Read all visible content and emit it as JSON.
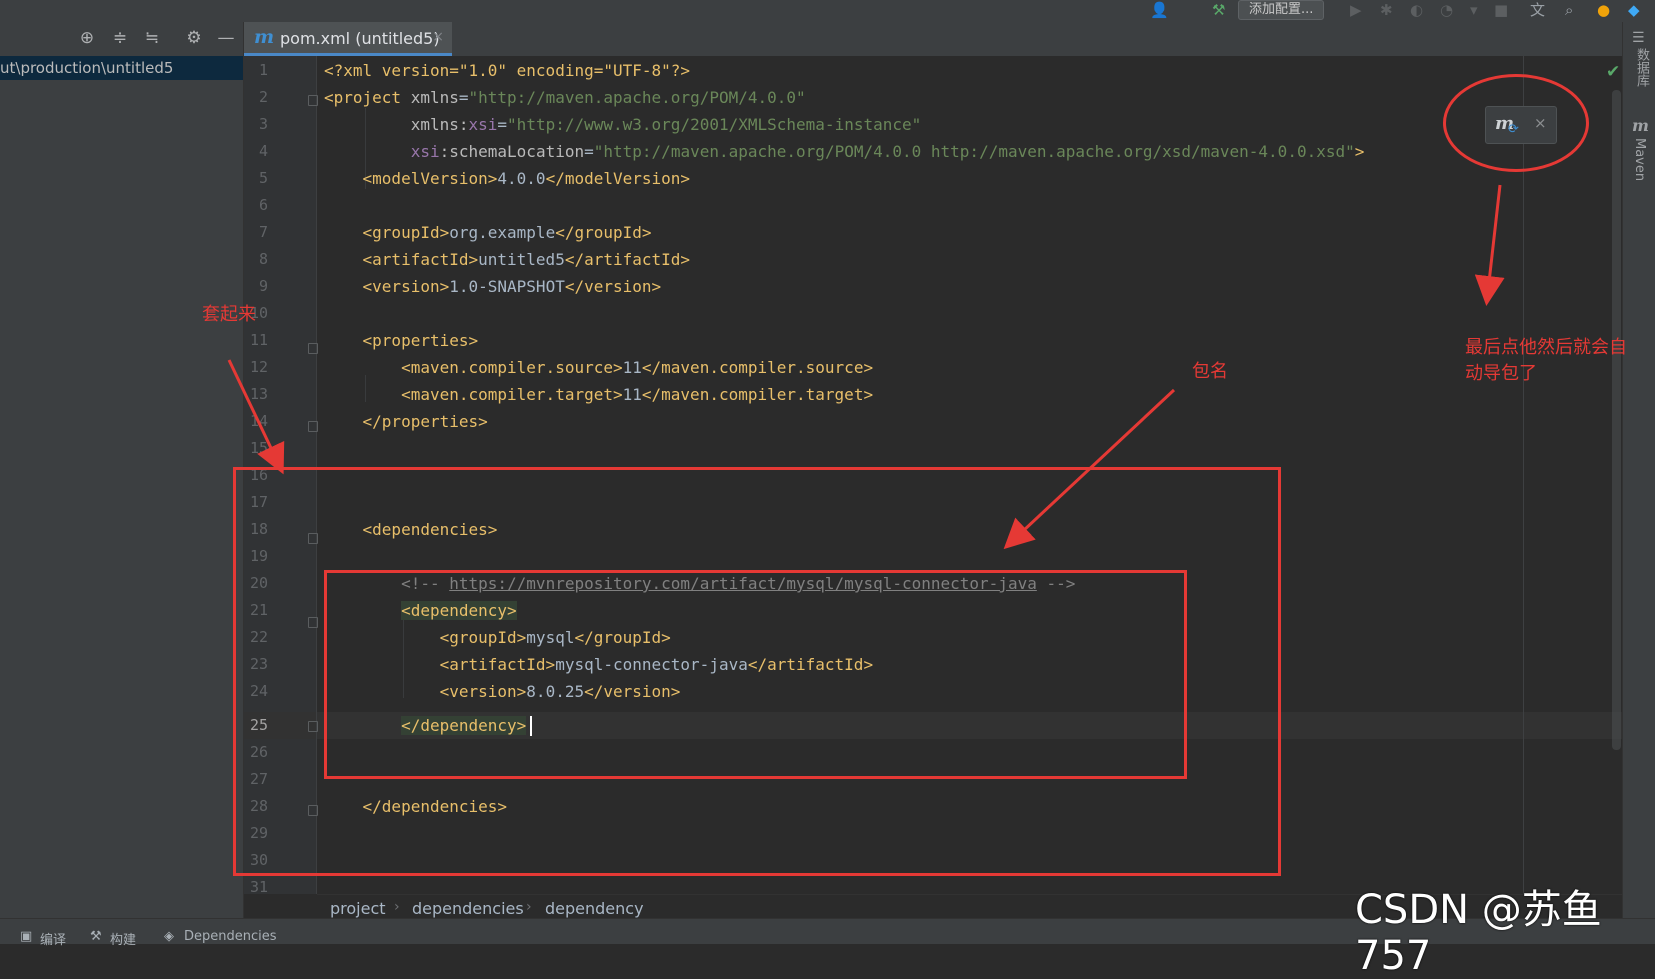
{
  "toolbar": {
    "run_config_label": "添加配置..."
  },
  "project_panel": {
    "path": "ut\\production\\untitled5"
  },
  "editor_tab": {
    "icon_letter": "m",
    "title": "pom.xml (untitled5)",
    "close": "×"
  },
  "line_numbers": [
    "1",
    "2",
    "3",
    "4",
    "5",
    "6",
    "7",
    "8",
    "9",
    "10",
    "11",
    "12",
    "13",
    "14",
    "15",
    "16",
    "17",
    "18",
    "19",
    "20",
    "21",
    "22",
    "23",
    "24",
    "25",
    "26",
    "27",
    "28",
    "29",
    "30",
    "31"
  ],
  "current_line": "25",
  "code": {
    "l1": "<?xml version=\"1.0\" encoding=\"UTF-8\"?>",
    "l2_open": "<project ",
    "l2_attr": "xmlns",
    "l2_val": "\"http://maven.apache.org/POM/4.0.0\"",
    "l3_ns_attr": "xmlns:",
    "l3_ns": "xsi",
    "l3_eq": "=",
    "l3_val": "\"http://www.w3.org/2001/XMLSchema-instance\"",
    "l4_ns": "xsi",
    "l4_attr": ":schemaLocation",
    "l4_eq": "=",
    "l4_val": "\"http://maven.apache.org/POM/4.0.0 http://maven.apache.org/xsd/maven-4.0.0.xsd\"",
    "l4_close": ">",
    "l5_open": "<modelVersion>",
    "l5_text": "4.0.0",
    "l5_close": "</modelVersion>",
    "l7_open": "<groupId>",
    "l7_text": "org.example",
    "l7_close": "</groupId>",
    "l8_open": "<artifactId>",
    "l8_text": "untitled5",
    "l8_close": "</artifactId>",
    "l9_open": "<version>",
    "l9_text": "1.0-SNAPSHOT",
    "l9_close": "</version>",
    "l11": "<properties>",
    "l12_open": "<maven.compiler.source>",
    "l12_text": "11",
    "l12_close": "</maven.compiler.source>",
    "l13_open": "<maven.compiler.target>",
    "l13_text": "11",
    "l13_close": "</maven.compiler.target>",
    "l14": "</properties>",
    "l18": "<dependencies>",
    "l20_start": "<!-- ",
    "l20_link": "https://mvnrepository.com/artifact/mysql/mysql-connector-java",
    "l20_end": " -->",
    "l21": "<dependency>",
    "l22_open": "<groupId>",
    "l22_text": "mysql",
    "l22_close": "</groupId>",
    "l23_open": "<artifactId>",
    "l23_text": "mysql-connector-java",
    "l23_close": "</artifactId>",
    "l24_open": "<version>",
    "l24_text": "8.0.25",
    "l24_close": "</version>",
    "l25": "</dependency>",
    "l28": "</dependencies>"
  },
  "maven_popup": {
    "icon": "m",
    "close": "×"
  },
  "right_strip": {
    "database": "数据库",
    "maven": "Maven"
  },
  "breadcrumb": [
    "project",
    "dependencies",
    "dependency"
  ],
  "bottom_tabs": [
    "编译",
    "构建",
    "Dependencies"
  ],
  "annotations": {
    "wrap": "套起来",
    "package_name": "包名",
    "final_click_line1": "最后点他然后就会自",
    "final_click_line2": "动导包了"
  },
  "watermark": "CSDN @苏鱼757",
  "colors": {
    "annotation_red": "#e53935",
    "tag": "#e8bf6a",
    "string": "#6a8759",
    "namespace": "#9876aa"
  }
}
